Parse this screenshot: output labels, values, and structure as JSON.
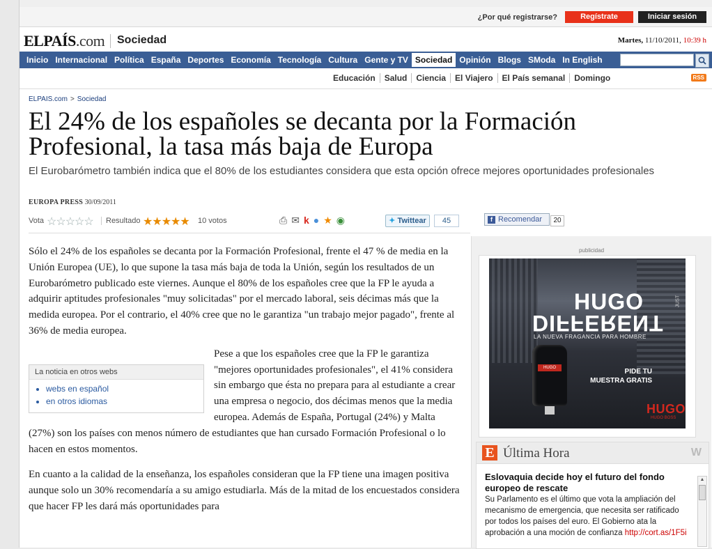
{
  "register_bar": {
    "why_label": "¿Por qué registrarse?",
    "register_label": "Regístrate",
    "login_label": "Iniciar sesión"
  },
  "header": {
    "logo_main": "ELPAÍS",
    "logo_suffix": ".com",
    "section": "Sociedad",
    "date_day": "Martes,",
    "date": "11/10/2011,",
    "time": "10:39 h"
  },
  "nav": {
    "items": [
      "Inicio",
      "Internacional",
      "Política",
      "España",
      "Deportes",
      "Economía",
      "Tecnología",
      "Cultura",
      "Gente y TV",
      "Sociedad",
      "Opinión",
      "Blogs",
      "SModa",
      "In English"
    ],
    "active": "Sociedad"
  },
  "subnav": {
    "items": [
      "Educación",
      "Salud",
      "Ciencia",
      "El Viajero",
      "El País semanal",
      "Domingo"
    ],
    "rss": "RSS"
  },
  "breadcrumb": {
    "home": "ELPAIS.com",
    "sep": ">",
    "section": "Sociedad"
  },
  "article": {
    "headline": "El 24% de los españoles se decanta por la Formación Profesional, la tasa más baja de Europa",
    "subtitle": "El Eurobarómetro también indica que el 80% de los estudiantes considera que esta opción ofrece mejores oportunidades profesionales",
    "agency": "EUROPA PRESS",
    "date": "30/09/2011",
    "rating": {
      "vote_label": "Vota",
      "result_label": "Resultado",
      "stars_empty": "☆☆☆☆☆",
      "stars_result": "★★★★★",
      "score": 4.5,
      "votes": "10 votos"
    },
    "tools": [
      "print-icon",
      "email-icon",
      "share-icon-1",
      "share-icon-2",
      "share-icon-3",
      "share-icon-4"
    ],
    "twitter_label": "Twittear",
    "twitter_count": "45",
    "facebook_label": "Recomendar",
    "facebook_count": "20",
    "paragraphs": [
      "Sólo el 24% de los españoles se decanta por la Formación Profesional, frente el 47 % de media en la Unión Europea (UE), lo que supone la tasa más baja de toda la Unión, según los resultados de un Eurobarómetro publicado este viernes. Aunque el 80% de los españoles cree que la FP le ayuda a adquirir aptitudes profesionales \"muy solicitadas\" por el mercado laboral, seis décimas más que la medida europea. Por el contrario, el 40% cree que no le garantiza \"un trabajo mejor pagado\", frente al 36% de media europea.",
      "Pese a que los españoles cree que la FP le garantiza \"mejores oportunidades profesionales\", el 41% considera sin embargo que ésta no prepara para al estudiante a crear una empresa o negocio, dos décimas menos que la media europea. Además de España, Portugal (24%) y Malta (27%) son los países con menos número de estudiantes que han cursado Formación Profesional o lo hacen en estos momentos.",
      "En cuanto a la calidad de la enseñanza, los españoles consideran que la FP tiene una imagen positiva aunque solo un 30% recomendaría a su amigo estudiarla. Más de la mitad de los encuestados considera que hacer FP les dará más oportunidades para"
    ],
    "other_webs": {
      "title": "La noticia en otros webs",
      "links": [
        "webs en español",
        "en otros idiomas"
      ]
    }
  },
  "sidebar": {
    "ad_label": "publicidad",
    "ad": {
      "brand_top": "HUGO",
      "brand_flipped": "DIFFERENT",
      "just": "JUST",
      "tagline": "LA NUEVA FRAGANCIA PARA HOMBRE",
      "cta_line1": "PIDE TU",
      "cta_line2": "MUESTRA GRATIS",
      "brand_bottom": "HUGO",
      "brand_sub": "HUGO BOSS",
      "bottle_label": "HUGO"
    },
    "ultima_hora": {
      "title": "Última Hora",
      "headline": "Eslovaquia decide hoy el futuro del fondo europeo de rescate",
      "text": "Su Parlamento es el último que vota la ampliación del mecanismo de emergencia, que necesita ser ratificado por todos los países del euro. El Gobierno ata la aprobación a una moción de confianza",
      "link": "http://cort.as/1F5i"
    }
  }
}
